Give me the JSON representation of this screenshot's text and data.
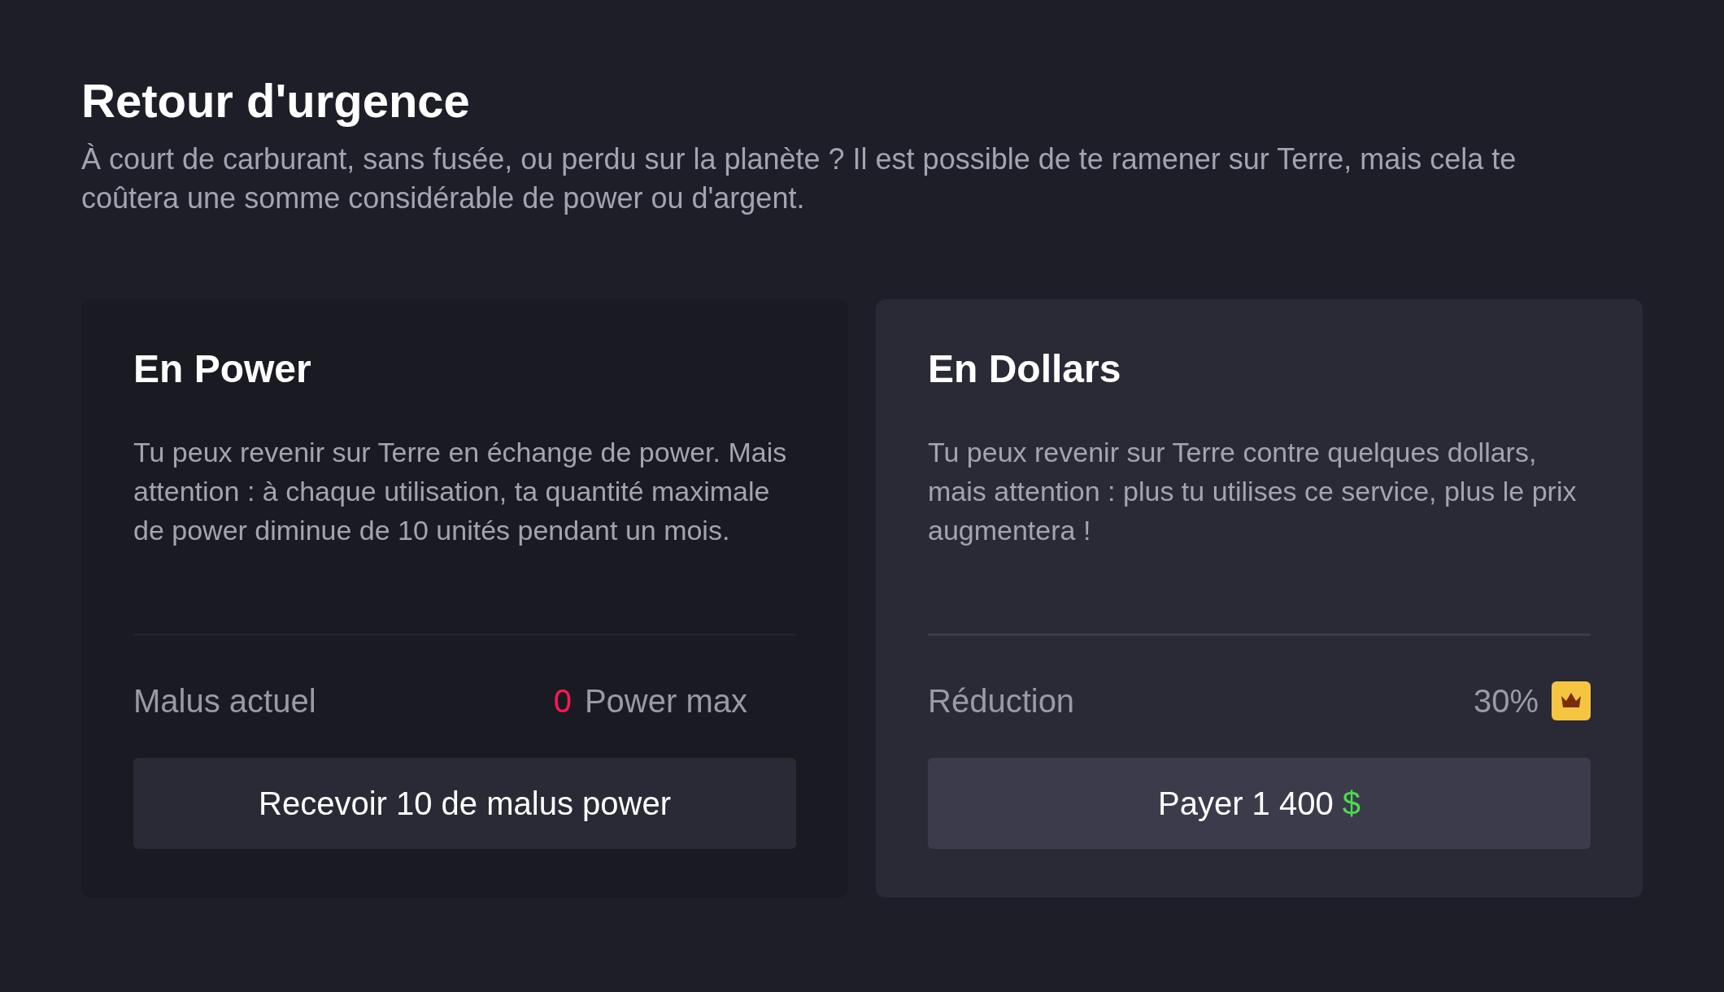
{
  "title": "Retour d'urgence",
  "description": "À court de carburant, sans fusée, ou perdu sur la planète ? Il est possible de te ramener sur Terre, mais cela te coûtera une somme considérable de power ou d'argent.",
  "cards": [
    {
      "kind": "power",
      "highlighted": false,
      "title": "En Power",
      "text": "Tu peux revenir sur Terre en échange de power. Mais attention : à chaque utilisation, ta quantité maximale de power diminue de 10 unités pendant un mois.",
      "stat_label": "Malus actuel",
      "stat_value": "0",
      "stat_unit": "Power max",
      "button": {
        "label": "Recevoir 10 de malus power"
      }
    },
    {
      "kind": "dollars",
      "highlighted": true,
      "title": "En Dollars",
      "text": "Tu peux revenir sur Terre contre quelques dollars, mais attention : plus tu utilises ce service, plus le prix augmentera !",
      "stat_label": "Réduction",
      "stat_value": "30%",
      "button": {
        "label": "Payer 1 400",
        "currency": "$"
      }
    }
  ]
}
